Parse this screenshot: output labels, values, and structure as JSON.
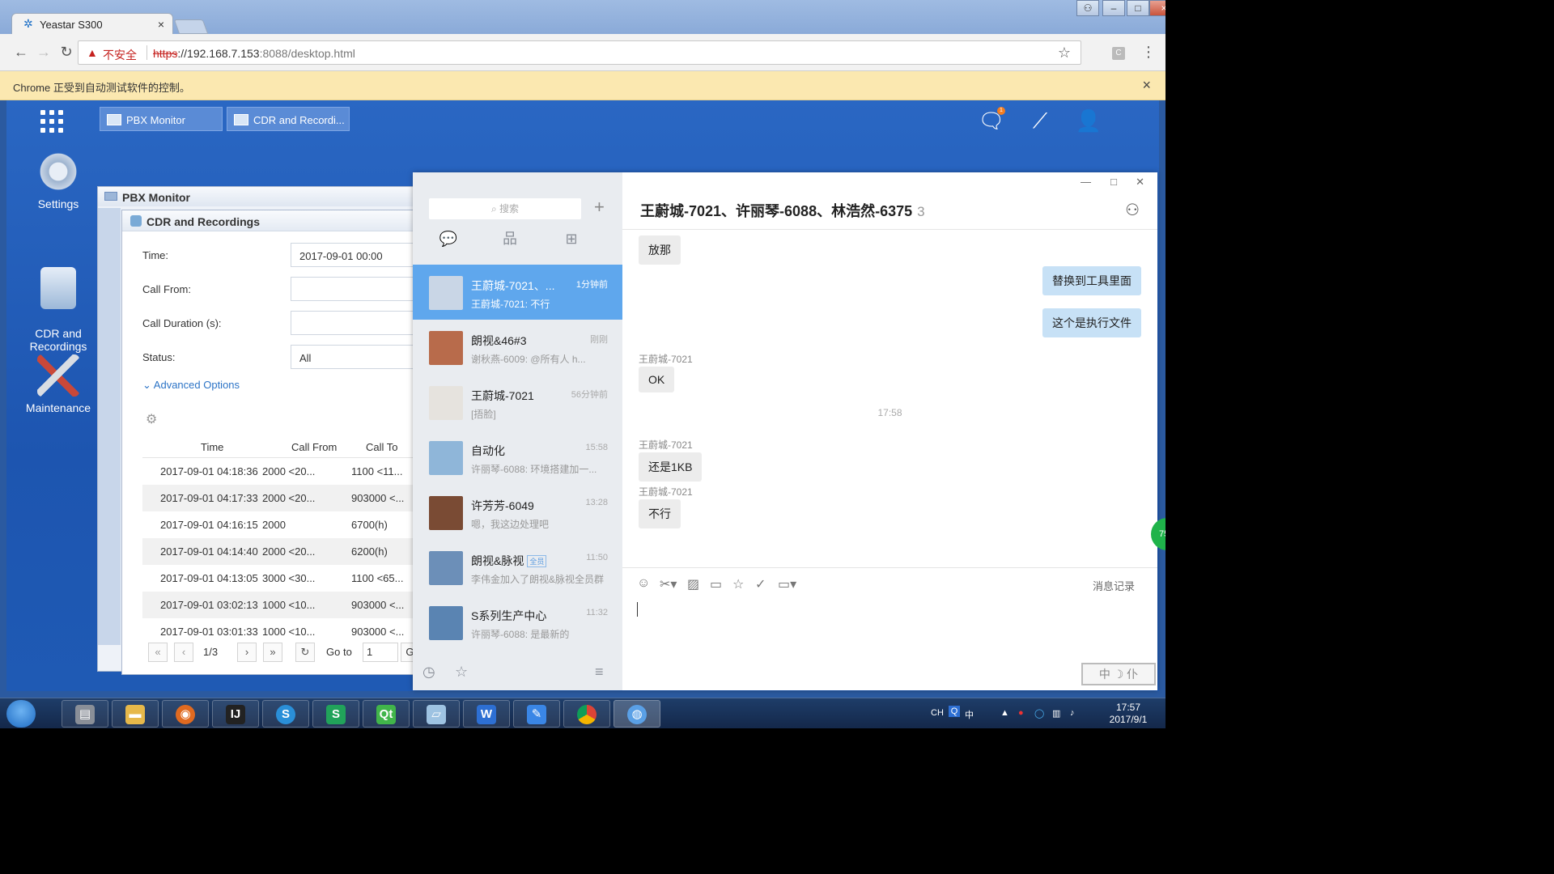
{
  "browser": {
    "tab_title": "Yeastar S300",
    "tab_close": "×",
    "insecure_label": "不安全",
    "url_scheme": "https",
    "url_host": "://192.168.7.153",
    "url_path": ":8088/desktop.html",
    "infobar_message": "Chrome 正受到自动测试软件的控制。",
    "infobar_close": "×",
    "window_controls": [
      "–",
      "□",
      "×"
    ]
  },
  "app": {
    "taskbar_buttons": [
      {
        "label": "PBX Monitor"
      },
      {
        "label": "CDR and Recordi..."
      }
    ],
    "desktop_icons": [
      {
        "label": "Settings"
      },
      {
        "label": "CDR and\nRecordings"
      },
      {
        "label": "Maintenance"
      }
    ],
    "notification_badge": "1"
  },
  "pbx_window": {
    "title": "PBX Monitor"
  },
  "cdr_window": {
    "title": "CDR and Recordings",
    "fields": {
      "time_label": "Time:",
      "time_value": "2017-09-01 00:00",
      "call_from_label": "Call From:",
      "call_duration_label": "Call Duration (s):",
      "status_label": "Status:",
      "status_value": "All"
    },
    "advanced_options": "Advanced Options",
    "table": {
      "columns": [
        "Time",
        "Call From",
        "Call To"
      ],
      "rows": [
        [
          "2017-09-01 04:18:36",
          "2000 <20...",
          "1100 <11..."
        ],
        [
          "2017-09-01 04:17:33",
          "2000 <20...",
          "903000 <..."
        ],
        [
          "2017-09-01 04:16:15",
          "2000",
          "6700(h)"
        ],
        [
          "2017-09-01 04:14:40",
          "2000 <20...",
          "6200(h)"
        ],
        [
          "2017-09-01 04:13:05",
          "3000 <30...",
          "1100 <65..."
        ],
        [
          "2017-09-01 03:02:13",
          "1000 <10...",
          "903000 <..."
        ],
        [
          "2017-09-01 03:01:33",
          "1000 <10...",
          "903000 <..."
        ]
      ]
    },
    "pager": {
      "page": "1/3",
      "goto_label": "Go to",
      "goto_value": "1",
      "go_button": "Go"
    }
  },
  "chat": {
    "search_placeholder": "搜索",
    "conversations": [
      {
        "name": "王蔚城-7021、...",
        "time": "1分钟前",
        "preview": "王蔚城-7021: 不行",
        "selected": true
      },
      {
        "name": "朗视&46#3",
        "time": "刚刚",
        "preview": "谢秋燕-6009: @所有人 h...",
        "selected": false
      },
      {
        "name": "王蔚城-7021",
        "time": "56分钟前",
        "preview": "[捂脸]",
        "selected": false
      },
      {
        "name": "自动化",
        "time": "15:58",
        "preview": "许丽琴-6088: 环境搭建加一...",
        "selected": false
      },
      {
        "name": "许芳芳-6049",
        "time": "13:28",
        "preview": "嗯，我这边处理吧",
        "selected": false
      },
      {
        "name": "朗视&脉视",
        "tag": "全员",
        "time": "11:50",
        "preview": "李伟金加入了朗视&脉视全员群",
        "selected": false
      },
      {
        "name": "S系列生产中心",
        "time": "11:32",
        "preview": "许丽琴-6088: 是最新的",
        "selected": false
      }
    ],
    "title": "王蔚城-7021、许丽琴-6088、林浩然-6375",
    "member_count": "3",
    "messages": [
      {
        "text": "放那",
        "mine": false
      },
      {
        "text": "替换到工具里面",
        "mine": true
      },
      {
        "text": "这个是执行文件",
        "mine": true
      },
      {
        "sender": "王蔚城-7021",
        "text": "OK",
        "mine": false
      },
      {
        "timestamp": "17:58"
      },
      {
        "sender": "王蔚城-7021",
        "text": "还是1KB",
        "mine": false
      },
      {
        "sender": "王蔚城-7021",
        "text": "不行",
        "mine": false
      }
    ],
    "history_label": "消息记录",
    "ime_stamp": "中 ☽ 仆"
  },
  "os_taskbar": {
    "tray_lang": "CH",
    "tray_ime": "中",
    "clock_time": "17:57",
    "clock_date": "2017/9/1"
  }
}
